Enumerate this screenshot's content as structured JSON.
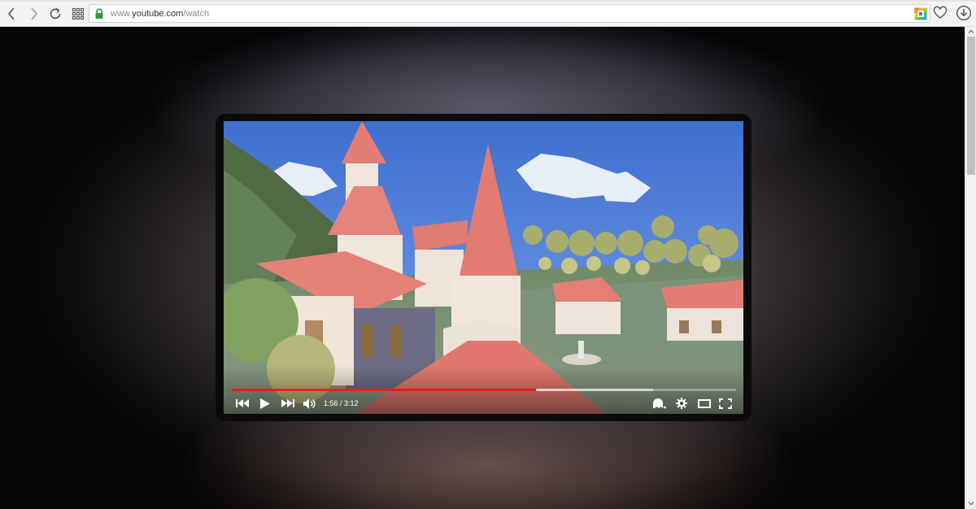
{
  "browser": {
    "url_prefix": "www.",
    "url_host": "youtube.com",
    "url_path": "/watch",
    "icons": {
      "back": "back-arrow-icon",
      "forward": "forward-arrow-icon",
      "reload": "reload-icon",
      "apps": "apps-grid-icon",
      "lock": "lock-icon",
      "extension": "snapshot-extension-icon",
      "favorite": "heart-icon",
      "download": "download-icon"
    }
  },
  "player": {
    "time_display": "1:56 / 3:12",
    "progress_played": 0.604,
    "progress_loaded": 0.835,
    "accent_color": "#e62117",
    "controls": {
      "previous": "previous-icon",
      "play": "play-icon",
      "next": "next-icon",
      "volume": "volume-icon",
      "annotations": "annotation-icon",
      "settings": "gear-icon",
      "theater": "theater-mode-icon",
      "fullscreen": "fullscreen-icon"
    }
  }
}
